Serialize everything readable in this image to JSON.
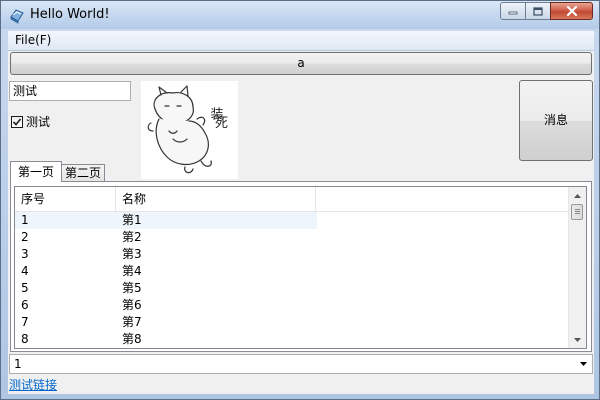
{
  "window": {
    "title": "Hello World!"
  },
  "menu": {
    "file_label": "File(F)"
  },
  "toolbar": {
    "a_button_label": "a"
  },
  "form": {
    "text_input_value": "测试",
    "checkbox_label": "测试",
    "checkbox_checked": true,
    "message_button_label": "消息"
  },
  "tabs": [
    {
      "label": "第一页",
      "active": true
    },
    {
      "label": "第二页",
      "active": false
    }
  ],
  "table": {
    "columns": [
      "序号",
      "名称"
    ],
    "rows": [
      [
        "1",
        "第1"
      ],
      [
        "2",
        "第2"
      ],
      [
        "3",
        "第3"
      ],
      [
        "4",
        "第4"
      ],
      [
        "5",
        "第5"
      ],
      [
        "6",
        "第6"
      ],
      [
        "7",
        "第7"
      ],
      [
        "8",
        "第8"
      ]
    ],
    "selected_row": 0
  },
  "combo": {
    "value": "1"
  },
  "link": {
    "label": "测试链接"
  },
  "picture": {
    "caption_glyphs": "装死"
  },
  "colors": {
    "link": "#0066cc",
    "close_button": "#c24a35",
    "title_bar": "#c5d8ef"
  }
}
